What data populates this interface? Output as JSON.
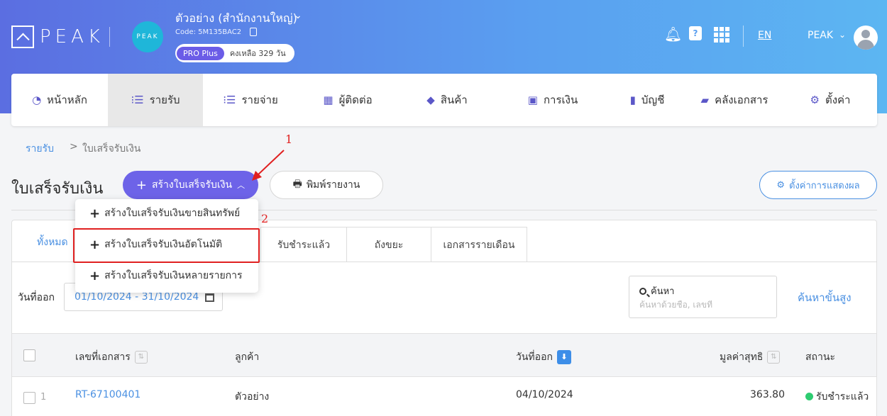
{
  "header": {
    "logo_text": "PEAK",
    "org_avatar_text": "PEAK",
    "org_name": "ตัวอย่าง (สำนักงานใหญ่)",
    "org_code": "Code: 5M135BAC2",
    "plan": "PRO Plus",
    "days_left": "คงเหลือ 329 วัน",
    "language": "EN",
    "user_name": "PEAK",
    "help_icon_text": "?"
  },
  "nav": [
    {
      "label": "หน้าหลัก",
      "icon": "dashboard-icon",
      "glyph": "◔"
    },
    {
      "label": "รายรับ",
      "icon": "income-icon",
      "glyph": "⁝☰"
    },
    {
      "label": "รายจ่าย",
      "icon": "expense-icon",
      "glyph": "⁝☰"
    },
    {
      "label": "ผู้ติดต่อ",
      "icon": "contacts-icon",
      "glyph": "▦"
    },
    {
      "label": "สินค้า",
      "icon": "product-icon",
      "glyph": "◆"
    },
    {
      "label": "การเงิน",
      "icon": "money-icon",
      "glyph": "▣"
    },
    {
      "label": "บัญชี",
      "icon": "ledger-icon",
      "glyph": "▮"
    },
    {
      "label": "คลังเอกสาร",
      "icon": "folder-icon",
      "glyph": "▰"
    },
    {
      "label": "ตั้งค่า",
      "icon": "gear-icon",
      "glyph": "⚙"
    }
  ],
  "breadcrumb": {
    "parent": "รายรับ",
    "separator": ">",
    "current": "ใบเสร็จรับเงิน"
  },
  "page_title": "ใบเสร็จรับเงิน",
  "buttons": {
    "create": "สร้างใบเสร็จรับเงิน",
    "print": "พิมพ์รายงาน",
    "display_settings": "ตั้งค่าการแสดงผล"
  },
  "dropdown": [
    "สร้างใบเสร็จรับเงินขายสินทรัพย์",
    "สร้างใบเสร็จรับเงินอัตโนมัติ",
    "สร้างใบเสร็จรับเงินหลายรายการ"
  ],
  "annotations": {
    "step1": "1",
    "step2": "2"
  },
  "tabs": [
    "ทั้งหมด",
    "รับชำระแล้ว",
    "ถังขยะ",
    "เอกสารรายเดือน"
  ],
  "filters": {
    "date_label": "วันที่ออก",
    "date_range": "01/10/2024 - 31/10/2024",
    "search_label": "ค้นหา",
    "search_placeholder": "ค้นหาด้วยชื่อ, เลขที่",
    "advanced_search": "ค้นหาขั้นสูง"
  },
  "table": {
    "columns": [
      "เลขที่เอกสาร",
      "ลูกค้า",
      "วันที่ออก",
      "มูลค่าสุทธิ",
      "สถานะ"
    ],
    "rows": [
      {
        "index": "1",
        "doc_no": "RT-67100401",
        "customer": "ตัวอย่าง",
        "date": "04/10/2024",
        "amount": "363.80",
        "status": "รับชำระแล้ว"
      }
    ]
  },
  "colors": {
    "primary": "#6d63e8",
    "link": "#4a90e2",
    "highlight": "#e02020",
    "status_paid": "#2ecc71"
  }
}
